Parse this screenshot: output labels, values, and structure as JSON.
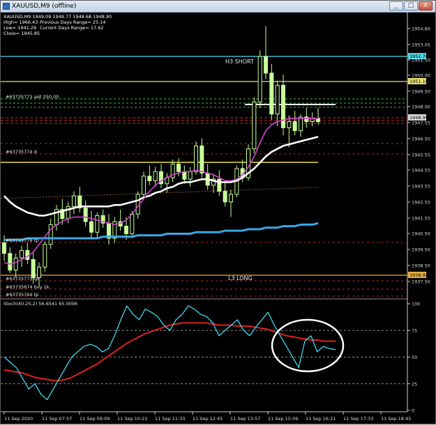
{
  "window": {
    "title": "XAUUSD,M9 (offline)",
    "buttons": [
      "_",
      "□",
      "X"
    ]
  },
  "info_panel": {
    "line1": "XAUUSD,M9  1949.09 1949.77 1948.68 1948.90",
    "high": "High= 1966.43",
    "low": "Low= 1941.29",
    "close": "Close= 1945.85",
    "prev_range": "Previous Days Range= 25.14",
    "curr_range": "Current Days Range= 17.62"
  },
  "levels": {
    "h3": "H3 SHORT",
    "l3": "L3 LONG"
  },
  "order_labels": {
    "sell": "#63735773 sell 250.00",
    "d": "#63735774 d",
    "tp_mid": "#63735776 tp",
    "tp_low": "#63735773 tp",
    "buy": "#63735674 buy 1k",
    "tp_bottom": "#63735764 tp"
  },
  "price_tags": {
    "t1952": "1952.76",
    "t1951": "1951.19",
    "t1948": "1948.90",
    "t1938": "1938.94"
  },
  "stoch_label": "Stoch(40,25,2) 56.6541 65.0096",
  "chart_data": [
    {
      "type": "line",
      "title": "XAUUSD,M9 (offline)",
      "y_ticks": [
        1954.6,
        1953.05,
        1951.5,
        1950.0,
        1949.5,
        1948.0,
        1947.55,
        1946.5,
        1945.55,
        1944.55,
        1943.55,
        1942.55,
        1941.55,
        1940.5,
        1939.5,
        1938.5,
        1937.5
      ],
      "x_ticks": [
        "11 Sep 2020",
        "11 Sep 07:57",
        "11 Sep 09:09",
        "11 Sep 10:21",
        "11 Sep 11:33",
        "11 Sep 12:45",
        "11 Sep 13:57",
        "11 Sep 15:09",
        "11 Sep 16:21",
        "11 Sep 17:33",
        "11 Sep 18:45"
      ],
      "ylim": [
        1937.2,
        1955.5
      ],
      "candles": [
        [
          1940.9,
          1941.4,
          1939.7,
          1940.2
        ],
        [
          1940.2,
          1940.6,
          1938.9,
          1939.1
        ],
        [
          1939.1,
          1940.2,
          1938.6,
          1939.9
        ],
        [
          1939.9,
          1940.7,
          1939.3,
          1940.4
        ],
        [
          1940.4,
          1940.9,
          1939.5,
          1939.8
        ],
        [
          1939.8,
          1940.3,
          1938.2,
          1938.6
        ],
        [
          1938.6,
          1939.6,
          1938.0,
          1939.3
        ],
        [
          1939.3,
          1941.0,
          1939.0,
          1940.8
        ],
        [
          1940.8,
          1942.5,
          1940.5,
          1942.1
        ],
        [
          1942.1,
          1943.4,
          1941.7,
          1943.1
        ],
        [
          1943.1,
          1943.8,
          1942.1,
          1942.5
        ],
        [
          1942.5,
          1943.6,
          1942.2,
          1943.3
        ],
        [
          1943.3,
          1944.3,
          1942.8,
          1944.0
        ],
        [
          1944.0,
          1944.6,
          1942.9,
          1943.2
        ],
        [
          1943.2,
          1943.7,
          1942.0,
          1942.3
        ],
        [
          1942.3,
          1943.0,
          1941.2,
          1941.6
        ],
        [
          1941.6,
          1942.9,
          1941.2,
          1942.7
        ],
        [
          1942.7,
          1943.1,
          1941.9,
          1942.2
        ],
        [
          1942.2,
          1942.8,
          1940.8,
          1941.2
        ],
        [
          1941.2,
          1942.6,
          1940.9,
          1942.3
        ],
        [
          1942.3,
          1943.1,
          1941.7,
          1942.0
        ],
        [
          1942.0,
          1942.6,
          1941.1,
          1941.5
        ],
        [
          1941.5,
          1943.0,
          1941.2,
          1942.8
        ],
        [
          1942.8,
          1944.3,
          1942.5,
          1944.1
        ],
        [
          1944.1,
          1945.6,
          1943.8,
          1945.3
        ],
        [
          1945.3,
          1946.0,
          1944.7,
          1945.0
        ],
        [
          1945.0,
          1945.9,
          1944.6,
          1945.6
        ],
        [
          1945.6,
          1946.1,
          1944.5,
          1944.8
        ],
        [
          1944.8,
          1945.5,
          1944.2,
          1945.2
        ],
        [
          1945.2,
          1946.4,
          1944.9,
          1946.1
        ],
        [
          1946.1,
          1946.5,
          1945.3,
          1945.6
        ],
        [
          1945.6,
          1946.0,
          1944.8,
          1945.1
        ],
        [
          1945.1,
          1945.9,
          1944.6,
          1945.6
        ],
        [
          1945.6,
          1947.6,
          1945.4,
          1947.3
        ],
        [
          1947.3,
          1947.8,
          1945.2,
          1945.5
        ],
        [
          1945.5,
          1946.1,
          1944.4,
          1944.7
        ],
        [
          1944.7,
          1945.4,
          1944.2,
          1945.1
        ],
        [
          1945.1,
          1945.7,
          1944.0,
          1944.3
        ],
        [
          1944.3,
          1944.9,
          1943.3,
          1943.6
        ],
        [
          1943.6,
          1944.4,
          1942.6,
          1944.1
        ],
        [
          1944.1,
          1946.0,
          1943.9,
          1945.8
        ],
        [
          1945.8,
          1946.4,
          1944.9,
          1945.2
        ],
        [
          1945.2,
          1947.4,
          1945.0,
          1947.1
        ],
        [
          1947.1,
          1950.5,
          1946.8,
          1950.2
        ],
        [
          1950.2,
          1953.6,
          1949.8,
          1953.2
        ],
        [
          1953.2,
          1955.2,
          1951.7,
          1952.1
        ],
        [
          1952.1,
          1952.7,
          1949.0,
          1949.4
        ],
        [
          1949.4,
          1951.6,
          1948.6,
          1951.3
        ],
        [
          1951.3,
          1952.0,
          1948.0,
          1948.5
        ],
        [
          1948.5,
          1949.3,
          1947.2,
          1948.9
        ],
        [
          1948.9,
          1949.6,
          1948.0,
          1948.3
        ],
        [
          1948.3,
          1949.4,
          1947.9,
          1949.2
        ],
        [
          1949.2,
          1949.8,
          1948.5,
          1948.9
        ],
        [
          1948.9,
          1949.5,
          1948.6,
          1949.1
        ],
        [
          1949.1,
          1949.8,
          1948.7,
          1948.9
        ]
      ],
      "ma_white": [
        1944.0,
        1943.6,
        1943.3,
        1943.1,
        1942.9,
        1942.8,
        1942.7,
        1942.7,
        1942.8,
        1942.9,
        1943.0,
        1943.1,
        1943.2,
        1943.3,
        1943.3,
        1943.3,
        1943.3,
        1943.3,
        1943.3,
        1943.4,
        1943.4,
        1943.5,
        1943.6,
        1943.7,
        1943.9,
        1944.0,
        1944.2,
        1944.3,
        1944.5,
        1944.6,
        1944.8,
        1944.9,
        1944.9,
        1945.0,
        1945.1,
        1945.1,
        1945.0,
        1944.9,
        1944.9,
        1944.9,
        1945.0,
        1945.2,
        1945.5,
        1945.8,
        1946.2,
        1946.6,
        1946.9,
        1947.1,
        1947.3,
        1947.4,
        1947.5,
        1947.6,
        1947.7,
        1947.8,
        1947.9
      ],
      "ma_blue": [
        1941.1,
        1941.1,
        1941.1,
        1941.1,
        1941.2,
        1941.2,
        1941.2,
        1941.2,
        1941.2,
        1941.2,
        1941.2,
        1941.2,
        1941.2,
        1941.2,
        1941.2,
        1941.2,
        1941.2,
        1941.3,
        1941.3,
        1941.3,
        1941.3,
        1941.3,
        1941.3,
        1941.4,
        1941.4,
        1941.4,
        1941.4,
        1941.4,
        1941.5,
        1941.5,
        1941.5,
        1941.5,
        1941.5,
        1941.6,
        1941.6,
        1941.6,
        1941.6,
        1941.6,
        1941.7,
        1941.7,
        1941.7,
        1941.7,
        1941.8,
        1941.8,
        1941.8,
        1941.9,
        1941.9,
        1941.9,
        1942.0,
        1942.0,
        1942.0,
        1942.1,
        1942.1,
        1942.1,
        1942.2
      ],
      "ma_magenta": [
        1939.6,
        1939.5,
        1939.6,
        1939.8,
        1940.0,
        1940.3,
        1940.8,
        1941.3,
        1941.8,
        1942.1,
        1942.3,
        1942.5,
        1942.6,
        1942.6,
        1942.6,
        1942.5,
        1942.4,
        1942.3,
        1942.2,
        1942.1,
        1942.2,
        1942.4,
        1942.8,
        1943.3,
        1943.8,
        1944.3,
        1944.7,
        1945.0,
        1945.2,
        1945.4,
        1945.5,
        1945.6,
        1945.6,
        1945.7,
        1945.6,
        1945.5,
        1945.4,
        1945.2,
        1945.0,
        1945.0,
        1945.1,
        1945.4,
        1945.9,
        1946.6,
        1947.5,
        1948.3,
        1948.7,
        1948.9,
        1949.0,
        1949.1,
        1949.1,
        1949.1,
        1949.1,
        1949.1,
        1949.1
      ]
    },
    {
      "type": "line",
      "title": "Stoch(40,25,2) 56.6541 65.0096",
      "y_ticks": [
        100,
        75,
        50,
        25,
        0
      ],
      "ylim": [
        0,
        100
      ],
      "series": [
        {
          "name": "Main",
          "values": [
            50,
            45,
            40,
            30,
            20,
            25,
            15,
            10,
            20,
            30,
            40,
            50,
            55,
            60,
            62,
            60,
            55,
            58,
            70,
            85,
            98,
            90,
            85,
            95,
            92,
            88,
            80,
            75,
            85,
            90,
            98,
            95,
            90,
            88,
            82,
            70,
            75,
            80,
            85,
            75,
            70,
            78,
            85,
            92,
            80,
            70,
            60,
            50,
            40,
            65,
            70,
            55,
            60,
            58,
            57
          ]
        },
        {
          "name": "Signal",
          "values": [
            38,
            37,
            36,
            35,
            33,
            31,
            30,
            29,
            28,
            28,
            29,
            31,
            34,
            37,
            40,
            43,
            47,
            51,
            55,
            59,
            63,
            66,
            69,
            72,
            74,
            76,
            78,
            80,
            81,
            82,
            82,
            82,
            82,
            82,
            81,
            80,
            80,
            80,
            79,
            79,
            79,
            78,
            77,
            76,
            74,
            72,
            70,
            69,
            68,
            67,
            66,
            66,
            65,
            65,
            65
          ]
        }
      ]
    }
  ]
}
